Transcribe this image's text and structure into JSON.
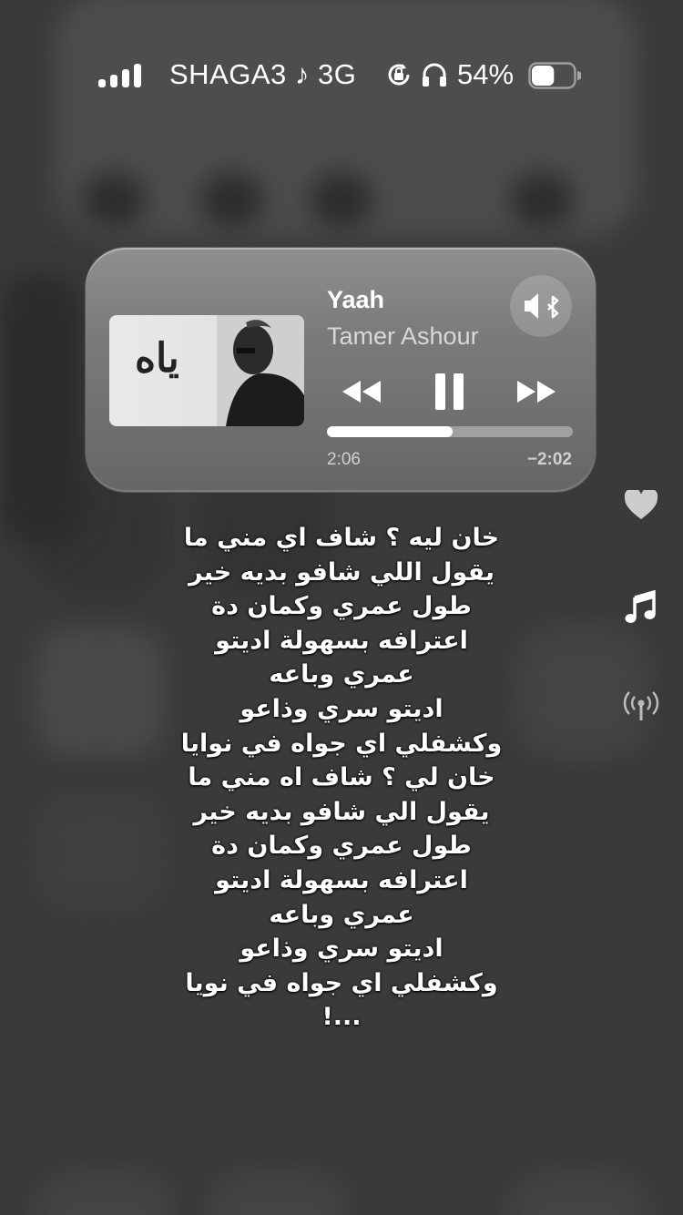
{
  "status_bar": {
    "carrier": "SHAGA3 ♪ 3G",
    "battery_percent": "54%",
    "signal_bars": 4,
    "battery_level": 0.54,
    "icons": [
      "orientation-lock-icon",
      "headphones-icon",
      "battery-icon"
    ]
  },
  "now_playing": {
    "title": "Yaah",
    "artist": "Tamer Ashour",
    "artwork_text": "ياه",
    "elapsed": "2:06",
    "remaining": "−2:02",
    "progress": 0.51,
    "controls": [
      "rewind-icon",
      "pause-icon",
      "fast-forward-icon"
    ],
    "route_icon": "speaker-bluetooth-icon"
  },
  "side_icons": [
    "heart-icon",
    "music-note-icon",
    "broadcast-icon"
  ],
  "lyrics": [
    "خان ليه ؟ شاف اي مني ما",
    "يقول اللي شافو بديه خير",
    "طول عمري وكمان دة",
    "اعترافه بسهولة اديتو",
    "عمري وباعه",
    "اديتو سري وذاعو",
    "وكشفلي اي جواه في نوايا",
    "خان لي ؟ شاف اه مني ما",
    "يقول الي شافو بديه خير",
    "طول عمري وكمان دة",
    "اعترافه بسهولة اديتو",
    "عمري وباعه",
    "اديتو سري وذاعو",
    "وكشفلي اي جواه في نويا",
    "...!"
  ]
}
